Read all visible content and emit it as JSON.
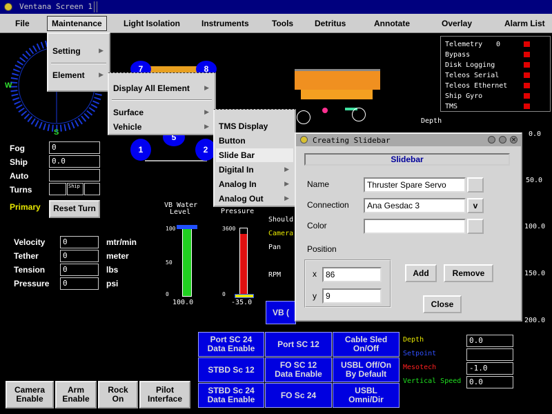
{
  "window": {
    "title": "Ventana Screen 1"
  },
  "menubar": [
    "File",
    "Maintenance",
    "Light Isolation",
    "Instruments",
    "Tools",
    "Detritus",
    "Annotate",
    "Overlay",
    "Alarm List"
  ],
  "maintenance_menu": [
    "Setting",
    "Element"
  ],
  "element_menu": [
    "Display All Element",
    "Surface",
    "Vehicle"
  ],
  "vehicle_menu": [
    "TMS Display",
    "Button",
    "Slide Bar",
    "Digital In",
    "Analog In",
    "Analog Out"
  ],
  "compass": {
    "w": "W",
    "s": "S"
  },
  "heading_fields": [
    {
      "label": "Fog",
      "value": "0"
    },
    {
      "label": "Ship",
      "value": "0.0"
    },
    {
      "label": "Auto",
      "value": ""
    },
    {
      "label": "Turns",
      "value": "",
      "ship_label": "Ship"
    }
  ],
  "primary": {
    "label": "Primary",
    "reset": "Reset Turn"
  },
  "measures": [
    {
      "label": "Velocity",
      "value": "0",
      "unit": "mtr/min"
    },
    {
      "label": "Tether",
      "value": "0",
      "unit": "meter"
    },
    {
      "label": "Tension",
      "value": "0",
      "unit": "lbs"
    },
    {
      "label": "Pressure",
      "value": "0",
      "unit": "psi"
    }
  ],
  "thrusters": [
    "7",
    "8",
    "1",
    "2",
    "5"
  ],
  "vb_water": {
    "title1": "VB Water",
    "title2": "Level",
    "t100": "100",
    "t50": "50",
    "t0": "0",
    "value": "100.0",
    "fraction": 1.0
  },
  "pressure_bar": {
    "title": "Pressure",
    "t3600": "3600",
    "t0": "0",
    "value": "-35.0",
    "fraction": 0.92
  },
  "camera_labels": [
    "Should",
    "Camera",
    "Pan",
    "RPM"
  ],
  "depth_scale": {
    "title": "Depth",
    "ticks": [
      "0.0",
      "50.0",
      "100.0",
      "150.0",
      "200.0"
    ]
  },
  "vb_button": "VB (",
  "status": [
    {
      "name": "Telemetry",
      "val": "0"
    },
    {
      "name": "Bypass",
      "val": ""
    },
    {
      "name": "Disk Logging",
      "val": ""
    },
    {
      "name": "Teleos Serial",
      "val": ""
    },
    {
      "name": "Teleos Ethernet",
      "val": ""
    },
    {
      "name": "Ship Gyro",
      "val": ""
    },
    {
      "name": "TMS",
      "val": ""
    }
  ],
  "dialog": {
    "title": "Creating Slidebar",
    "heading": "Slidebar",
    "name_label": "Name",
    "name_value": "Thruster Spare Servo",
    "conn_label": "Connection",
    "conn_value": "Ana Gesdac 3",
    "conn_btn": "v",
    "color_label": "Color",
    "position_label": "Position",
    "x_label": "x",
    "x_value": "86",
    "y_label": "y",
    "y_value": "9",
    "add": "Add",
    "remove": "Remove",
    "close": "Close"
  },
  "blue_buttons": [
    [
      "Port SC 24\nData Enable",
      "Port SC 12",
      "Cable Sled\nOn/Off"
    ],
    [
      "STBD Sc 12",
      "FO SC 12\nData Enable",
      "USBL Off/On\nBy Default"
    ],
    [
      "STBD Sc 24\nData Enable",
      "FO Sc 24",
      "USBL\nOmni/Dir"
    ]
  ],
  "readouts": [
    {
      "label": "Depth",
      "value": "0.0",
      "color": "#e8e800"
    },
    {
      "label": "Setpoint",
      "value": "",
      "color": "#3050ff"
    },
    {
      "label": "Mesotech",
      "value": "-1.0",
      "color": "#ff2020"
    },
    {
      "label": "Vertical Speed",
      "value": "0.0",
      "color": "#20e020"
    }
  ],
  "bottom_buttons": [
    "Camera\nEnable",
    "Arm\nEnable",
    "Rock\nOn",
    "Pilot\nInterface"
  ]
}
